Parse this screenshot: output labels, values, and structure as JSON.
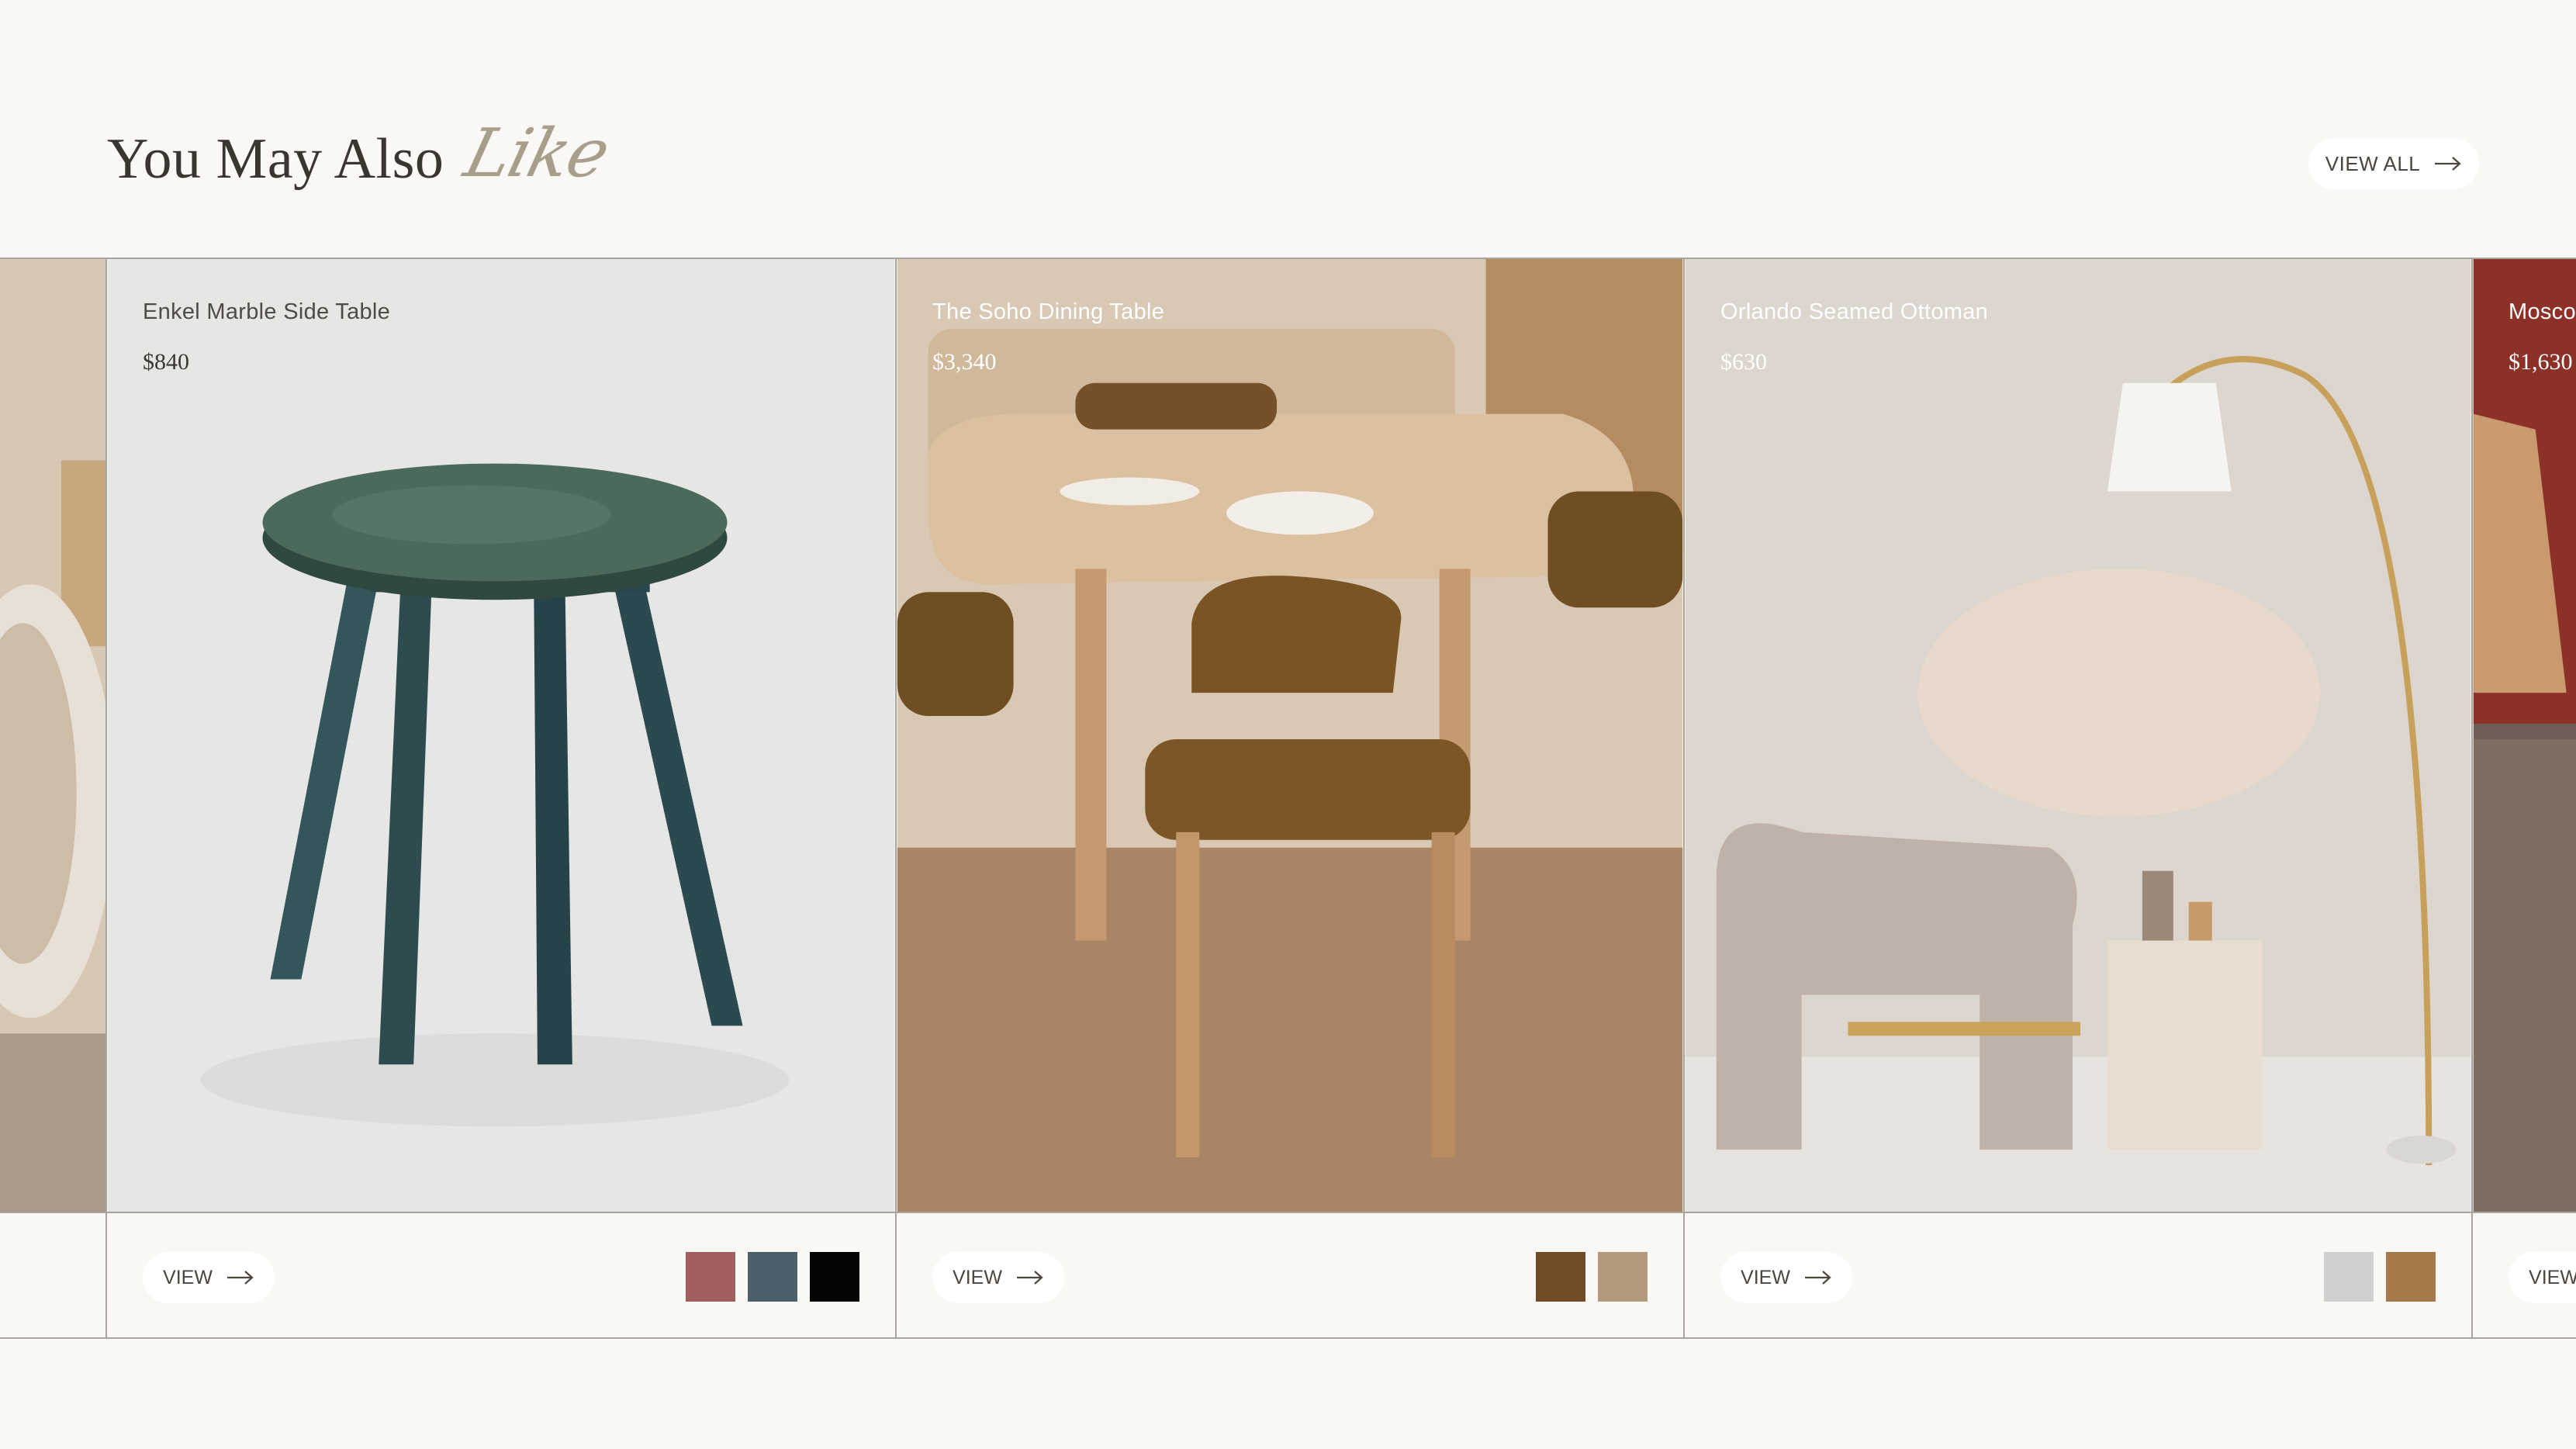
{
  "header": {
    "title": "You May Also",
    "title_script": "Like",
    "view_all_label": "VIEW ALL"
  },
  "products": [
    {
      "name": "Enkel Marble Side Table",
      "price": "$840",
      "view_label": "VIEW",
      "swatches": [
        "#a35f5f",
        "#4a5f68",
        "#050505"
      ]
    },
    {
      "name": "The Soho Dining Table",
      "price": "$3,340",
      "view_label": "VIEW",
      "swatches": [
        "#714a26",
        "#b49a7d"
      ]
    },
    {
      "name": "Orlando Seamed Ottoman",
      "price": "$630",
      "view_label": "VIEW",
      "swatches": [
        "#d0d0d0",
        "#a57a4a"
      ]
    },
    {
      "name": "Moscow",
      "price": "$1,630",
      "view_label": "VIEW"
    }
  ],
  "icons": {
    "arrow": "arrow-right-icon"
  }
}
